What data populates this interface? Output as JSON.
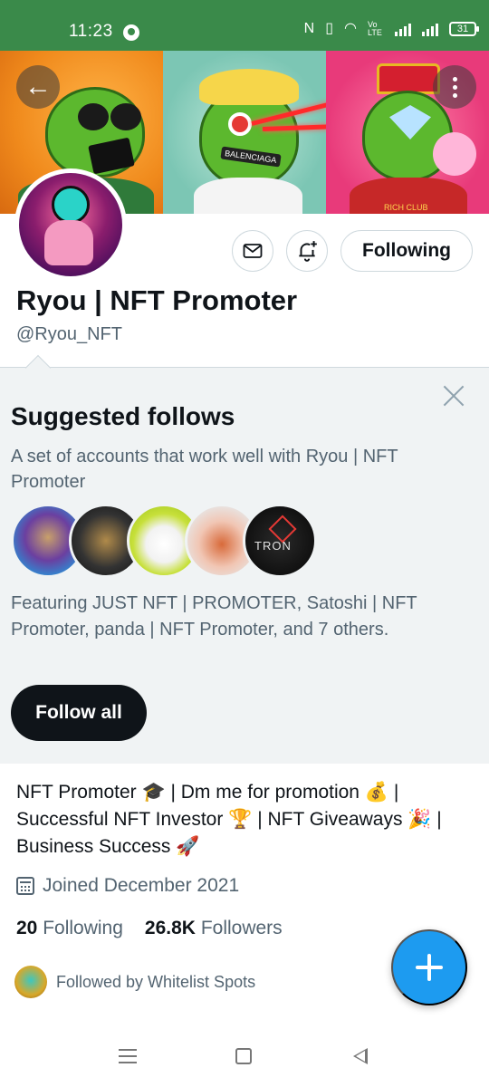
{
  "status_bar": {
    "time": "11:23",
    "battery": "31",
    "volte": "Vo LTE"
  },
  "profile": {
    "display_name": "Ryou | NFT Promoter",
    "handle": "@Ryou_NFT",
    "following_button": "Following",
    "banner_texts": [
      "BALENCIAGA",
      "RICH CLUB"
    ]
  },
  "suggested": {
    "title": "Suggested follows",
    "description": "A set of accounts that work well with Ryou | NFT Promoter",
    "avatar_label": "TRON",
    "featuring": "Featuring JUST NFT | PROMOTER, Satoshi | NFT Promoter, panda | NFT Promoter, and 7 others.",
    "follow_all": "Follow all"
  },
  "bio": {
    "line1_a": "NFT Promoter",
    "line1_b": " | Dm me for promotion",
    "line1_c": " |",
    "line2_a": "Successful NFT Investor",
    "line2_b": " | NFT Giveaways",
    "line2_c": " |",
    "line3_a": "Business Success",
    "emoji_grad": "🎓",
    "emoji_money": "💰",
    "emoji_trophy": "🏆",
    "emoji_party": "🎉",
    "emoji_rocket": "🚀"
  },
  "joined": "Joined December 2021",
  "stats": {
    "following_count": "20",
    "following_label": "Following",
    "followers_count": "26.8K",
    "followers_label": "Followers"
  },
  "followed_by": "Followed by Whitelist Spots",
  "colors": {
    "status_bar": "#3a8a4a",
    "accent": "#1d9bf0",
    "text_primary": "#0f1419",
    "text_secondary": "#536471"
  }
}
